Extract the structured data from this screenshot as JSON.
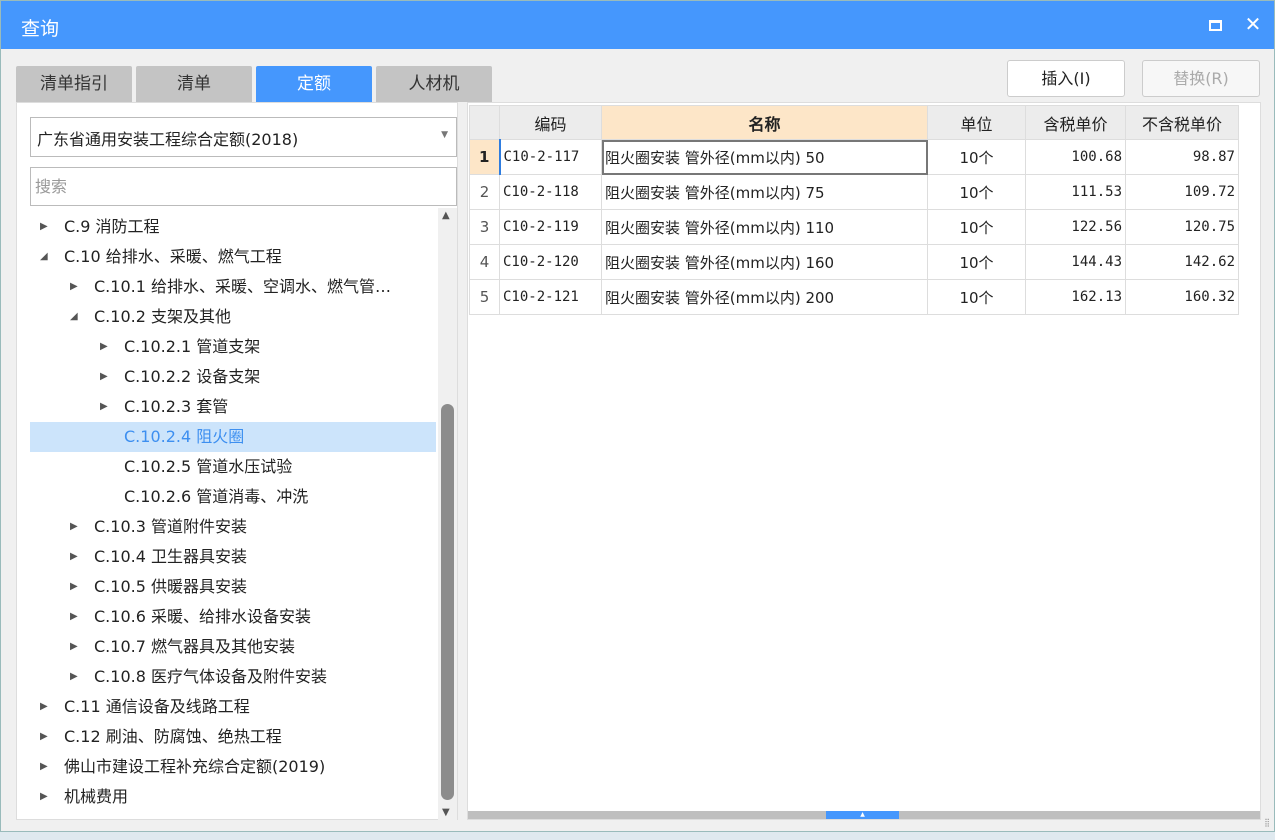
{
  "window": {
    "title": "查询",
    "maximize_icon": "maximize-icon",
    "close_icon": "close-icon"
  },
  "tabs": [
    {
      "label": "清单指引"
    },
    {
      "label": "清单"
    },
    {
      "label": "定额",
      "active": true
    },
    {
      "label": "人材机"
    }
  ],
  "buttons": {
    "insert": "插入(I)",
    "replace": "替换(R)"
  },
  "library_select": {
    "value": "广东省通用安装工程综合定额(2018)"
  },
  "search": {
    "placeholder": "搜索",
    "value": ""
  },
  "tree": [
    {
      "label": "C.9 消防工程",
      "level": 0,
      "state": "collapsed"
    },
    {
      "label": "C.10 给排水、采暖、燃气工程",
      "level": 0,
      "state": "expanded"
    },
    {
      "label": "C.10.1 给排水、采暖、空调水、燃气管…",
      "level": 1,
      "state": "collapsed"
    },
    {
      "label": "C.10.2 支架及其他",
      "level": 1,
      "state": "expanded"
    },
    {
      "label": "C.10.2.1 管道支架",
      "level": 2,
      "state": "collapsed"
    },
    {
      "label": "C.10.2.2 设备支架",
      "level": 2,
      "state": "collapsed"
    },
    {
      "label": "C.10.2.3 套管",
      "level": 2,
      "state": "collapsed"
    },
    {
      "label": "C.10.2.4 阻火圈",
      "level": 2,
      "state": "leaf",
      "selected": true
    },
    {
      "label": "C.10.2.5 管道水压试验",
      "level": 2,
      "state": "leaf"
    },
    {
      "label": "C.10.2.6 管道消毒、冲洗",
      "level": 2,
      "state": "leaf"
    },
    {
      "label": "C.10.3 管道附件安装",
      "level": 1,
      "state": "collapsed"
    },
    {
      "label": "C.10.4 卫生器具安装",
      "level": 1,
      "state": "collapsed"
    },
    {
      "label": "C.10.5 供暖器具安装",
      "level": 1,
      "state": "collapsed"
    },
    {
      "label": "C.10.6 采暖、给排水设备安装",
      "level": 1,
      "state": "collapsed"
    },
    {
      "label": "C.10.7 燃气器具及其他安装",
      "level": 1,
      "state": "collapsed"
    },
    {
      "label": "C.10.8 医疗气体设备及附件安装",
      "level": 1,
      "state": "collapsed"
    },
    {
      "label": "C.11 通信设备及线路工程",
      "level": 0,
      "state": "collapsed"
    },
    {
      "label": "C.12 刷油、防腐蚀、绝热工程",
      "level": 0,
      "state": "collapsed"
    },
    {
      "label": "佛山市建设工程补充综合定额(2019)",
      "level": 0,
      "state": "collapsed"
    },
    {
      "label": "机械费用",
      "level": 0,
      "state": "collapsed"
    }
  ],
  "table": {
    "columns": [
      "",
      "编码",
      "名称",
      "单位",
      "含税单价",
      "不含税单价"
    ],
    "rows": [
      {
        "no": "1",
        "code": "C10-2-117",
        "name": "阻火圈安装 管外径(mm以内) 50",
        "unit": "10个",
        "tax_price": "100.68",
        "notax_price": "98.87"
      },
      {
        "no": "2",
        "code": "C10-2-118",
        "name": "阻火圈安装 管外径(mm以内) 75",
        "unit": "10个",
        "tax_price": "111.53",
        "notax_price": "109.72"
      },
      {
        "no": "3",
        "code": "C10-2-119",
        "name": "阻火圈安装 管外径(mm以内) 110",
        "unit": "10个",
        "tax_price": "122.56",
        "notax_price": "120.75"
      },
      {
        "no": "4",
        "code": "C10-2-120",
        "name": "阻火圈安装 管外径(mm以内) 160",
        "unit": "10个",
        "tax_price": "144.43",
        "notax_price": "142.62"
      },
      {
        "no": "5",
        "code": "C10-2-121",
        "name": "阻火圈安装 管外径(mm以内) 200",
        "unit": "10个",
        "tax_price": "162.13",
        "notax_price": "160.32"
      }
    ]
  },
  "colors": {
    "accent": "#4597fd",
    "selected_row": "#cce4fb",
    "header_highlight": "#fde6c8"
  }
}
